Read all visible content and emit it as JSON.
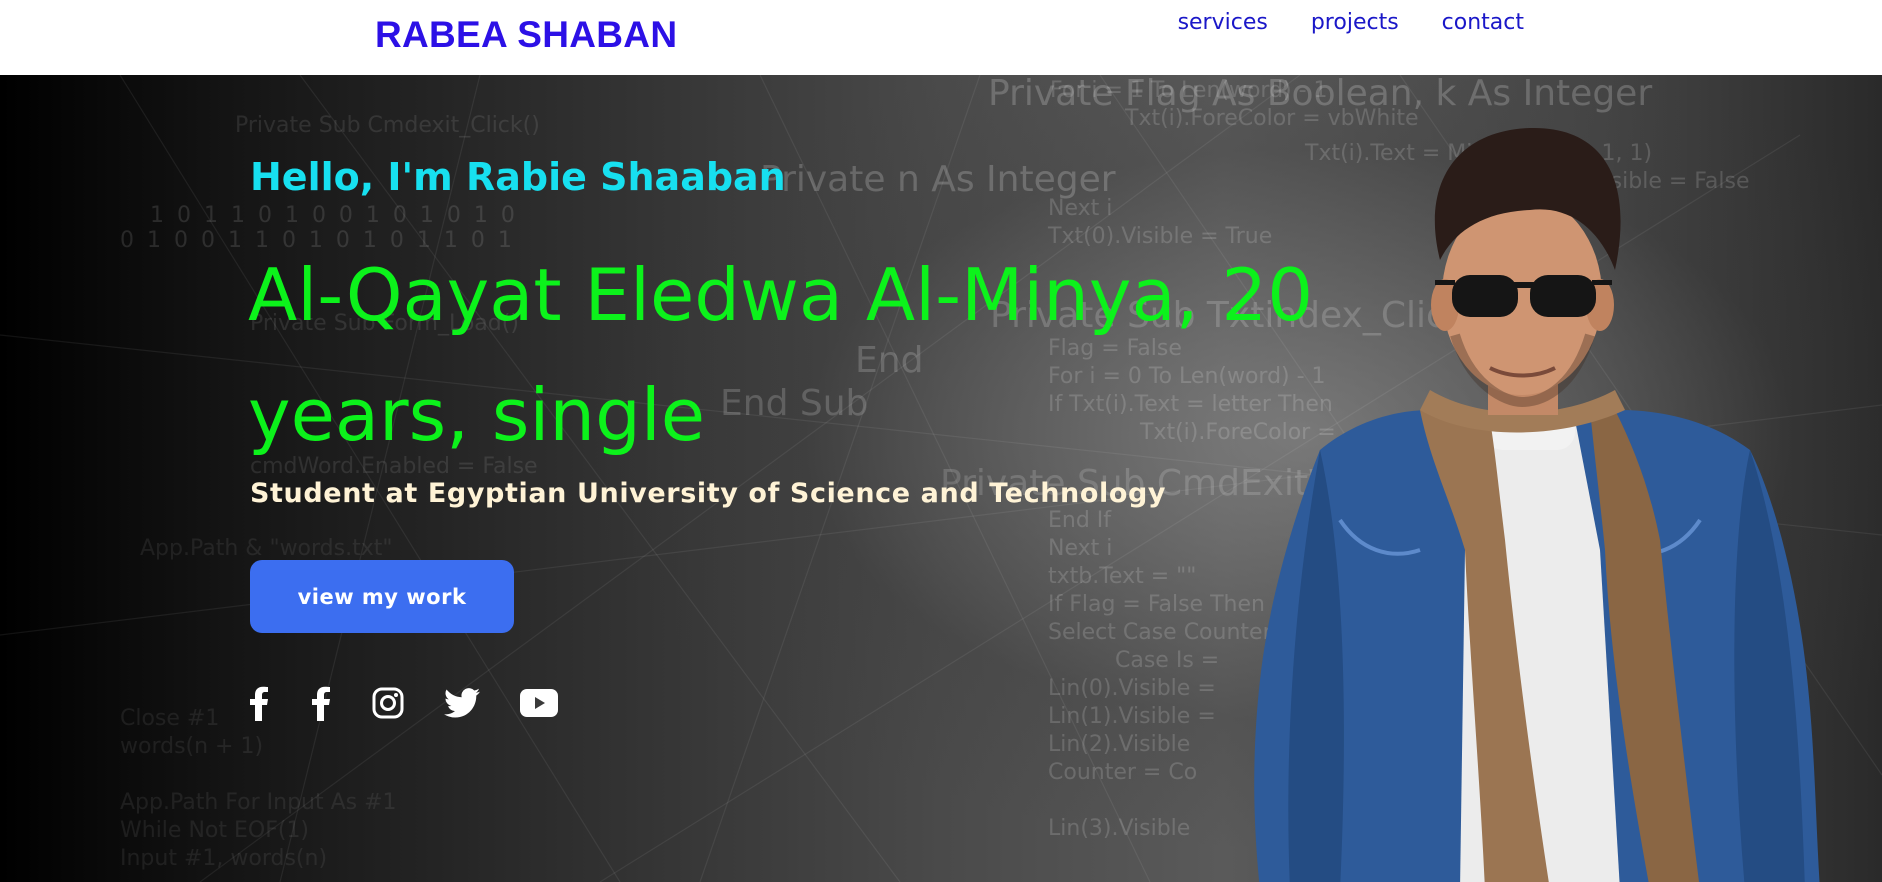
{
  "header": {
    "brand": "RABEA SHABAN",
    "nav": [
      {
        "label": "services"
      },
      {
        "label": "projects"
      },
      {
        "label": "contact"
      }
    ]
  },
  "hero": {
    "greeting": "Hello, I'm Rabie Shaaban",
    "headline": "Al-Qayat Eledwa Al-Minya, 20 years, single",
    "subtitle": "Student at Egyptian University of Science and Technology",
    "cta_label": "view my work",
    "background_code_lines": [
      "Private Flag As Boolean, k As Integer",
      "For i = 1 To Len(word) - 1",
      "Txt(i).ForeColor = vbWhite",
      "Txt(i).Text = Mid(word, i + 1, 1)",
      "Visible = False",
      "Private Sub Cmdexit_Click()",
      "Private n As Integer",
      "1 0 1 1 0 1 0 0 1 0 1 0 1 0",
      "0 1 0 0 1 1 0 1 0 1 0 1 1 0 1",
      "Next i",
      "Txt(0).Visible = True",
      "Private Sub Form_Load()",
      "Private Sub Txtindex_Click()",
      "Flag = False",
      "For i = 0 To Len(word) - 1",
      "If Txt(i).Text = letter Then",
      "Txt(i).ForeColor =",
      "End",
      "End Sub",
      "cmdWord.Enabled = False",
      "Private Sub CmdExitWord_Click",
      "End If",
      "Next i",
      "txtb.Text = \"\"",
      "If Flag = False Then",
      "Select Case Counter",
      "Case Is =",
      "Lin(0).Visible =",
      "Lin(1).Visible =",
      "Lin(2).Visible",
      "Counter = Co",
      "Lin(3).Visible",
      "App.Path & \"words.txt\"",
      "Close #1",
      "words(n + 1)",
      "App.Path For Input As #1",
      "While Not EOF(1)",
      "Input #1, words(n)"
    ]
  },
  "socials": [
    {
      "icon": "facebook-icon"
    },
    {
      "icon": "facebook-icon"
    },
    {
      "icon": "instagram-icon"
    },
    {
      "icon": "twitter-icon"
    },
    {
      "icon": "youtube-icon"
    }
  ],
  "colors": {
    "brand": "#2c10e6",
    "nav": "#1a17c8",
    "greeting": "#17e0f0",
    "headline": "#0cf21b",
    "subtitle": "#fff3d6",
    "cta_bg": "#3c6ef0"
  }
}
